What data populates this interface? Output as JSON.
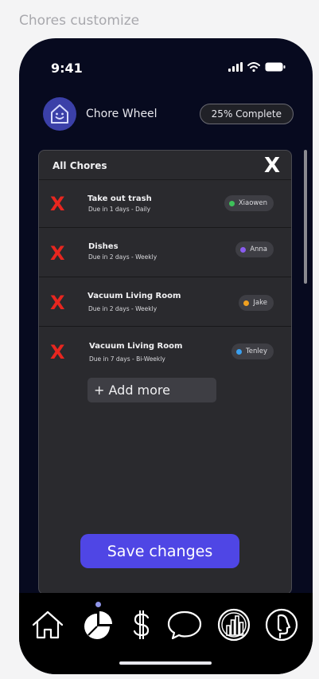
{
  "frame_label": "Chores customize",
  "status": {
    "time": "9:41"
  },
  "header": {
    "title": "Chore Wheel",
    "progress": "25% Complete"
  },
  "panel": {
    "title": "All Chores",
    "close_label": "X",
    "remove_label": "X",
    "chores": [
      {
        "name": "Take out trash",
        "due": "Due in 1 days - Daily",
        "assignee": "Xiaowen",
        "color": "#3ec15a"
      },
      {
        "name": "Dishes",
        "due": "Due in 2 days - Weekly",
        "assignee": "Anna",
        "color": "#8a5cf0"
      },
      {
        "name": "Vacuum Living Room",
        "due": "Due in 2 days - Weekly",
        "assignee": "Jake",
        "color": "#f0a020"
      },
      {
        "name": "Vacuum Living Room",
        "due": "Due in 7 days - Bi-Weekly",
        "assignee": "Tenley",
        "color": "#3aa0f0"
      }
    ],
    "add_more_label": "+ Add more",
    "save_label": "Save changes"
  },
  "colors": {
    "accent": "#4f46e5",
    "danger": "#e8261f",
    "panel": "#2a2a2e",
    "background": "#070a1f"
  },
  "tabbar": {
    "tabs": [
      {
        "icon": "home-icon"
      },
      {
        "icon": "pie-chart-icon"
      },
      {
        "icon": "dollar-icon"
      },
      {
        "icon": "chat-bubble-icon"
      },
      {
        "icon": "bar-chart-icon"
      },
      {
        "icon": "profile-icon"
      }
    ]
  }
}
